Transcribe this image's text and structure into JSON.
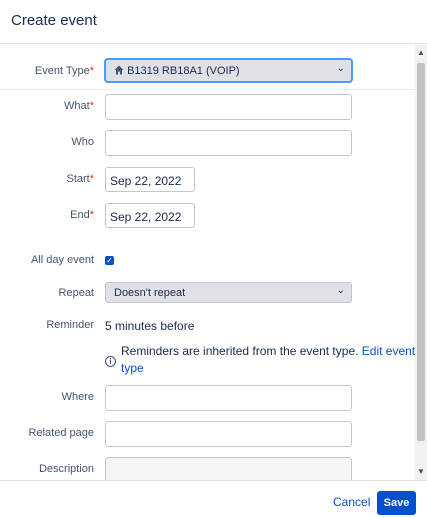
{
  "dialog": {
    "title": "Create event"
  },
  "form": {
    "event_type": {
      "label": "Event Type",
      "required_mark": "*",
      "value": "B1319 RB18A1 (VOIP)",
      "icon": "home-icon"
    },
    "what": {
      "label": "What",
      "required_mark": "*",
      "value": ""
    },
    "who": {
      "label": "Who",
      "value": ""
    },
    "start": {
      "label": "Start",
      "required_mark": "*",
      "value": "Sep 22, 2022"
    },
    "end": {
      "label": "End",
      "required_mark": "*",
      "value": "Sep 22, 2022"
    },
    "all_day": {
      "label": "All day event",
      "checked": true
    },
    "repeat": {
      "label": "Repeat",
      "value": "Doesn't repeat"
    },
    "reminder": {
      "label": "Reminder",
      "value": "5 minutes before",
      "info_text": "Reminders are inherited from the event type.",
      "info_link": "Edit event type"
    },
    "where": {
      "label": "Where",
      "value": ""
    },
    "related_page": {
      "label": "Related page",
      "value": ""
    },
    "description": {
      "label": "Description",
      "value": ""
    }
  },
  "footer": {
    "cancel_label": "Cancel",
    "save_label": "Save"
  },
  "colors": {
    "primary": "#0052cc",
    "required": "#de350b",
    "focus": "#4c9aff"
  }
}
